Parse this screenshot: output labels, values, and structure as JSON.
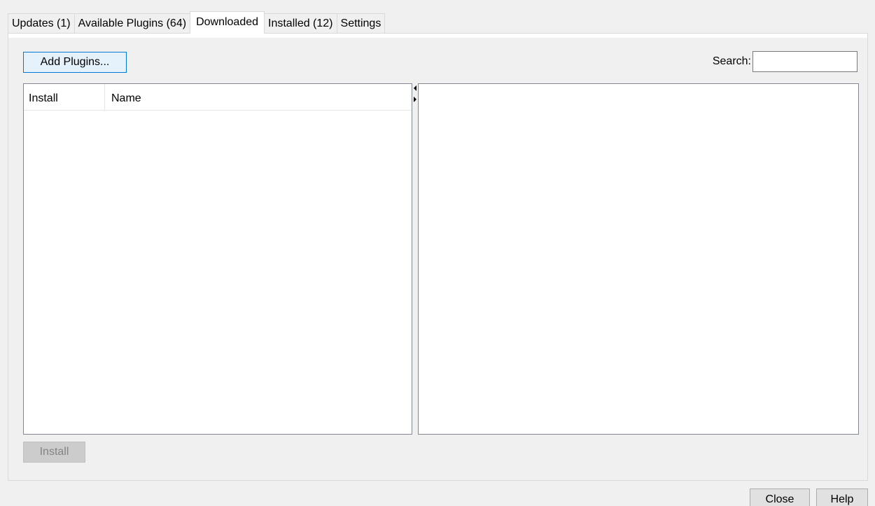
{
  "tabs": [
    {
      "label": "Updates (1)"
    },
    {
      "label": "Available Plugins (64)"
    },
    {
      "label": "Downloaded"
    },
    {
      "label": "Installed (12)"
    },
    {
      "label": "Settings"
    }
  ],
  "active_tab": "Downloaded",
  "toolbar": {
    "add_plugins_label": "Add Plugins...",
    "search_label": "Search:",
    "search_value": ""
  },
  "plugin_list": {
    "columns": [
      "Install",
      "Name"
    ],
    "rows": []
  },
  "actions": {
    "install_label": "Install",
    "close_label": "Close",
    "help_label": "Help"
  }
}
